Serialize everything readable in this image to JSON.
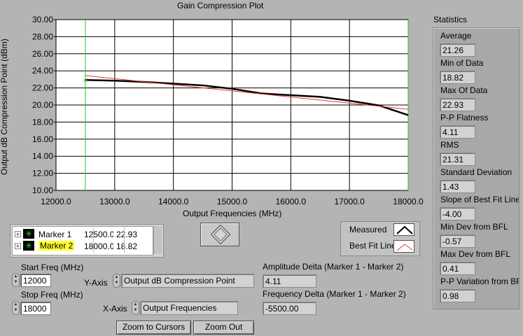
{
  "graph": {
    "title": "Gain Compression Plot",
    "ylabel": "Output dB Compression Point (dBm)",
    "xlabel": "Output Frequencies (MHz)",
    "xticks": [
      "12000.0",
      "13000.0",
      "14000.0",
      "15000.0",
      "16000.0",
      "17000.0",
      "18000.0"
    ],
    "yticks": [
      "30.00",
      "28.00",
      "26.00",
      "24.00",
      "22.00",
      "20.00",
      "18.00",
      "16.00",
      "14.00",
      "12.00",
      "10.00"
    ]
  },
  "chart_data": {
    "type": "line",
    "x_range": [
      12000,
      18000
    ],
    "y_range": [
      10,
      30
    ],
    "series": [
      {
        "name": "Measured",
        "color": "#000000",
        "x": [
          12500,
          13000,
          13500,
          14000,
          14500,
          15000,
          15500,
          16000,
          16500,
          17000,
          17500,
          18000
        ],
        "y": [
          22.93,
          22.85,
          22.7,
          22.5,
          22.3,
          21.9,
          21.35,
          21.15,
          20.95,
          20.5,
          19.95,
          18.82
        ]
      },
      {
        "name": "Best Fit Line",
        "color": "#e03a3a",
        "x": [
          12500,
          18000
        ],
        "y": [
          23.45,
          19.5
        ]
      }
    ],
    "cursors_x": [
      12500,
      18000
    ],
    "cursor_color": "#2dbb2d",
    "grid": true
  },
  "markers": [
    {
      "label": "Marker 1",
      "x": "12500.0",
      "y": "22.93",
      "highlight": false
    },
    {
      "label": "Marker 2",
      "x": "18000.0",
      "y": "18.82",
      "highlight": true
    }
  ],
  "legend": [
    {
      "label": "Measured"
    },
    {
      "label": "Best Fit Line"
    }
  ],
  "controls": {
    "start_freq_label": "Start Freq (MHz)",
    "start_freq": "12000",
    "stop_freq_label": "Stop Freq (MHz)",
    "stop_freq": "18000",
    "yaxis_label": "Y-Axis",
    "yaxis_value": "Output dB Compression Point",
    "xaxis_label": "X-Axis",
    "xaxis_value": "Output Frequencies",
    "amp_delta_label": "Amplitude Delta (Marker 1 - Marker 2)",
    "amp_delta": "4.11",
    "freq_delta_label": "Frequency Delta (Marker 1 - Marker 2)",
    "freq_delta": "-5500.00",
    "zoom_cursors": "Zoom to Cursors",
    "zoom_out": "Zoom Out"
  },
  "statistics": {
    "title": "Statistics",
    "items": [
      {
        "label": "Average",
        "value": "21.26"
      },
      {
        "label": "Min of Data",
        "value": "18.82"
      },
      {
        "label": "Max Of Data",
        "value": "22.93"
      },
      {
        "label": "P-P Flatness",
        "value": "4.11"
      },
      {
        "label": "RMS",
        "value": "21.31"
      },
      {
        "label": "Standard Deviation",
        "value": "1.43"
      },
      {
        "label": "Slope of Best Fit Line",
        "value": "-4.00"
      },
      {
        "label": "Min Dev from BFL",
        "value": "-0.57"
      },
      {
        "label": "Max Dev from BFL",
        "value": "0.41"
      },
      {
        "label": "P-P Variation from BFL",
        "value": "0.98"
      }
    ]
  }
}
